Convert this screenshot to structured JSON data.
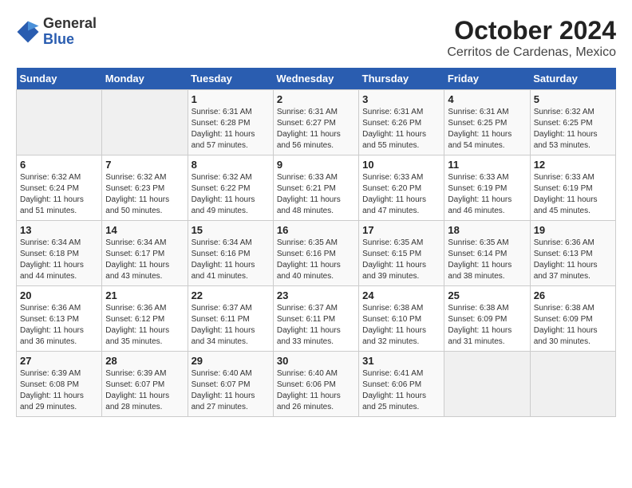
{
  "logo": {
    "line1": "General",
    "line2": "Blue"
  },
  "title": "October 2024",
  "subtitle": "Cerritos de Cardenas, Mexico",
  "weekdays": [
    "Sunday",
    "Monday",
    "Tuesday",
    "Wednesday",
    "Thursday",
    "Friday",
    "Saturday"
  ],
  "weeks": [
    [
      {
        "day": "",
        "sunrise": "",
        "sunset": "",
        "daylight": ""
      },
      {
        "day": "",
        "sunrise": "",
        "sunset": "",
        "daylight": ""
      },
      {
        "day": "1",
        "sunrise": "Sunrise: 6:31 AM",
        "sunset": "Sunset: 6:28 PM",
        "daylight": "Daylight: 11 hours and 57 minutes."
      },
      {
        "day": "2",
        "sunrise": "Sunrise: 6:31 AM",
        "sunset": "Sunset: 6:27 PM",
        "daylight": "Daylight: 11 hours and 56 minutes."
      },
      {
        "day": "3",
        "sunrise": "Sunrise: 6:31 AM",
        "sunset": "Sunset: 6:26 PM",
        "daylight": "Daylight: 11 hours and 55 minutes."
      },
      {
        "day": "4",
        "sunrise": "Sunrise: 6:31 AM",
        "sunset": "Sunset: 6:25 PM",
        "daylight": "Daylight: 11 hours and 54 minutes."
      },
      {
        "day": "5",
        "sunrise": "Sunrise: 6:32 AM",
        "sunset": "Sunset: 6:25 PM",
        "daylight": "Daylight: 11 hours and 53 minutes."
      }
    ],
    [
      {
        "day": "6",
        "sunrise": "Sunrise: 6:32 AM",
        "sunset": "Sunset: 6:24 PM",
        "daylight": "Daylight: 11 hours and 51 minutes."
      },
      {
        "day": "7",
        "sunrise": "Sunrise: 6:32 AM",
        "sunset": "Sunset: 6:23 PM",
        "daylight": "Daylight: 11 hours and 50 minutes."
      },
      {
        "day": "8",
        "sunrise": "Sunrise: 6:32 AM",
        "sunset": "Sunset: 6:22 PM",
        "daylight": "Daylight: 11 hours and 49 minutes."
      },
      {
        "day": "9",
        "sunrise": "Sunrise: 6:33 AM",
        "sunset": "Sunset: 6:21 PM",
        "daylight": "Daylight: 11 hours and 48 minutes."
      },
      {
        "day": "10",
        "sunrise": "Sunrise: 6:33 AM",
        "sunset": "Sunset: 6:20 PM",
        "daylight": "Daylight: 11 hours and 47 minutes."
      },
      {
        "day": "11",
        "sunrise": "Sunrise: 6:33 AM",
        "sunset": "Sunset: 6:19 PM",
        "daylight": "Daylight: 11 hours and 46 minutes."
      },
      {
        "day": "12",
        "sunrise": "Sunrise: 6:33 AM",
        "sunset": "Sunset: 6:19 PM",
        "daylight": "Daylight: 11 hours and 45 minutes."
      }
    ],
    [
      {
        "day": "13",
        "sunrise": "Sunrise: 6:34 AM",
        "sunset": "Sunset: 6:18 PM",
        "daylight": "Daylight: 11 hours and 44 minutes."
      },
      {
        "day": "14",
        "sunrise": "Sunrise: 6:34 AM",
        "sunset": "Sunset: 6:17 PM",
        "daylight": "Daylight: 11 hours and 43 minutes."
      },
      {
        "day": "15",
        "sunrise": "Sunrise: 6:34 AM",
        "sunset": "Sunset: 6:16 PM",
        "daylight": "Daylight: 11 hours and 41 minutes."
      },
      {
        "day": "16",
        "sunrise": "Sunrise: 6:35 AM",
        "sunset": "Sunset: 6:16 PM",
        "daylight": "Daylight: 11 hours and 40 minutes."
      },
      {
        "day": "17",
        "sunrise": "Sunrise: 6:35 AM",
        "sunset": "Sunset: 6:15 PM",
        "daylight": "Daylight: 11 hours and 39 minutes."
      },
      {
        "day": "18",
        "sunrise": "Sunrise: 6:35 AM",
        "sunset": "Sunset: 6:14 PM",
        "daylight": "Daylight: 11 hours and 38 minutes."
      },
      {
        "day": "19",
        "sunrise": "Sunrise: 6:36 AM",
        "sunset": "Sunset: 6:13 PM",
        "daylight": "Daylight: 11 hours and 37 minutes."
      }
    ],
    [
      {
        "day": "20",
        "sunrise": "Sunrise: 6:36 AM",
        "sunset": "Sunset: 6:13 PM",
        "daylight": "Daylight: 11 hours and 36 minutes."
      },
      {
        "day": "21",
        "sunrise": "Sunrise: 6:36 AM",
        "sunset": "Sunset: 6:12 PM",
        "daylight": "Daylight: 11 hours and 35 minutes."
      },
      {
        "day": "22",
        "sunrise": "Sunrise: 6:37 AM",
        "sunset": "Sunset: 6:11 PM",
        "daylight": "Daylight: 11 hours and 34 minutes."
      },
      {
        "day": "23",
        "sunrise": "Sunrise: 6:37 AM",
        "sunset": "Sunset: 6:11 PM",
        "daylight": "Daylight: 11 hours and 33 minutes."
      },
      {
        "day": "24",
        "sunrise": "Sunrise: 6:38 AM",
        "sunset": "Sunset: 6:10 PM",
        "daylight": "Daylight: 11 hours and 32 minutes."
      },
      {
        "day": "25",
        "sunrise": "Sunrise: 6:38 AM",
        "sunset": "Sunset: 6:09 PM",
        "daylight": "Daylight: 11 hours and 31 minutes."
      },
      {
        "day": "26",
        "sunrise": "Sunrise: 6:38 AM",
        "sunset": "Sunset: 6:09 PM",
        "daylight": "Daylight: 11 hours and 30 minutes."
      }
    ],
    [
      {
        "day": "27",
        "sunrise": "Sunrise: 6:39 AM",
        "sunset": "Sunset: 6:08 PM",
        "daylight": "Daylight: 11 hours and 29 minutes."
      },
      {
        "day": "28",
        "sunrise": "Sunrise: 6:39 AM",
        "sunset": "Sunset: 6:07 PM",
        "daylight": "Daylight: 11 hours and 28 minutes."
      },
      {
        "day": "29",
        "sunrise": "Sunrise: 6:40 AM",
        "sunset": "Sunset: 6:07 PM",
        "daylight": "Daylight: 11 hours and 27 minutes."
      },
      {
        "day": "30",
        "sunrise": "Sunrise: 6:40 AM",
        "sunset": "Sunset: 6:06 PM",
        "daylight": "Daylight: 11 hours and 26 minutes."
      },
      {
        "day": "31",
        "sunrise": "Sunrise: 6:41 AM",
        "sunset": "Sunset: 6:06 PM",
        "daylight": "Daylight: 11 hours and 25 minutes."
      },
      {
        "day": "",
        "sunrise": "",
        "sunset": "",
        "daylight": ""
      },
      {
        "day": "",
        "sunrise": "",
        "sunset": "",
        "daylight": ""
      }
    ]
  ]
}
